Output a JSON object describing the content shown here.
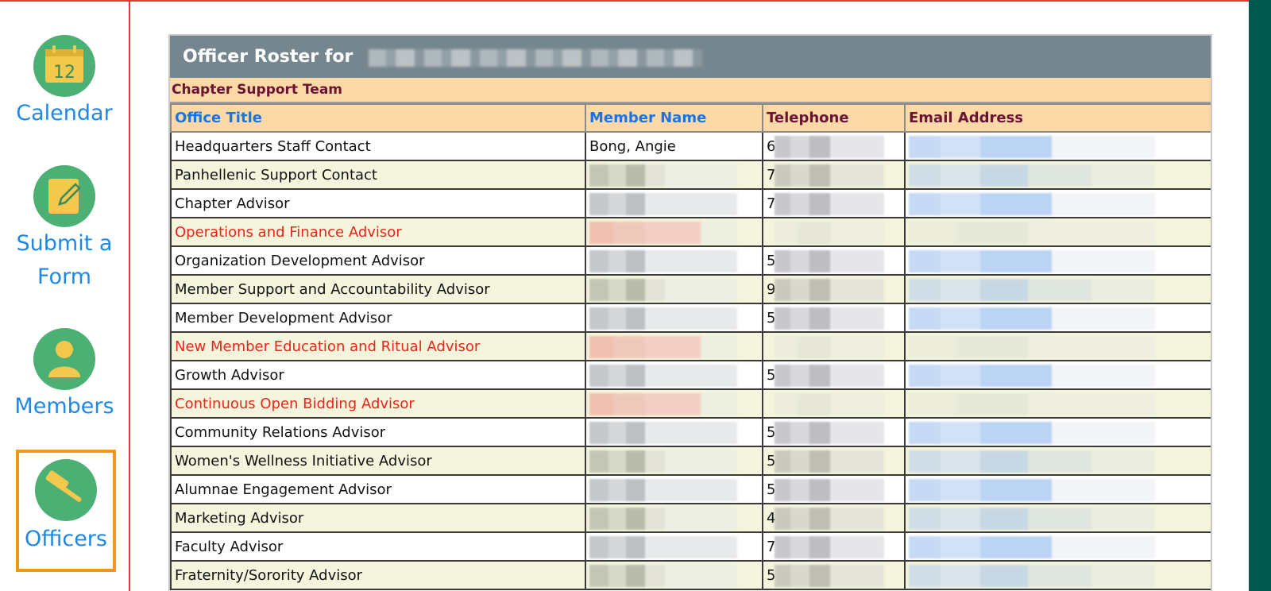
{
  "sidebar": {
    "items": [
      {
        "label_lines": [
          "Calendar"
        ],
        "icon": "calendar-icon",
        "icon_text": "12",
        "active": false
      },
      {
        "label_lines": [
          "Submit a",
          "Form"
        ],
        "icon": "form-edit-icon",
        "active": false
      },
      {
        "label_lines": [
          "Members"
        ],
        "icon": "person-icon",
        "active": false
      },
      {
        "label_lines": [
          "Officers"
        ],
        "icon": "gavel-icon",
        "active": true
      }
    ]
  },
  "panel": {
    "title": "Officer Roster for",
    "section": "Chapter Support Team",
    "columns": [
      "Office Title",
      "Member Name",
      "Telephone",
      "Email Address"
    ]
  },
  "rows": [
    {
      "title": "Headquarters Staff Contact",
      "name": "Bong, Angie",
      "red": false,
      "tel_lead": "6"
    },
    {
      "title": "Panhellenic Support Contact",
      "name": "",
      "red": false,
      "tel_lead": "7"
    },
    {
      "title": "Chapter Advisor",
      "name": "",
      "red": false,
      "tel_lead": "7"
    },
    {
      "title": "Operations and Finance Advisor",
      "name": "",
      "red": true,
      "tel_lead": ""
    },
    {
      "title": "Organization Development Advisor",
      "name": "",
      "red": false,
      "tel_lead": "5"
    },
    {
      "title": "Member Support and Accountability Advisor",
      "name": "",
      "red": false,
      "tel_lead": "9"
    },
    {
      "title": "Member Development Advisor",
      "name": "",
      "red": false,
      "tel_lead": "5"
    },
    {
      "title": "New Member Education and Ritual Advisor",
      "name": "",
      "red": true,
      "tel_lead": ""
    },
    {
      "title": "Growth Advisor",
      "name": "",
      "red": false,
      "tel_lead": "5"
    },
    {
      "title": "Continuous Open Bidding Advisor",
      "name": "",
      "red": true,
      "tel_lead": ""
    },
    {
      "title": "Community Relations Advisor",
      "name": "",
      "red": false,
      "tel_lead": "5"
    },
    {
      "title": "Women's Wellness Initiative Advisor",
      "name": "",
      "red": false,
      "tel_lead": "5"
    },
    {
      "title": "Alumnae Engagement Advisor",
      "name": "",
      "red": false,
      "tel_lead": "5"
    },
    {
      "title": "Marketing Advisor",
      "name": "",
      "red": false,
      "tel_lead": "4"
    },
    {
      "title": "Faculty Advisor",
      "name": "",
      "red": false,
      "tel_lead": "7"
    },
    {
      "title": "Fraternity/Sorority Advisor",
      "name": "",
      "red": false,
      "tel_lead": "5"
    }
  ],
  "colors": {
    "accent_red": "#e53935",
    "icon_green": "#4caf74",
    "link_blue": "#1e88e5",
    "active_orange": "#f7941d",
    "header_gray": "#76868f",
    "section_peach": "#fcd9a7",
    "right_bar": "#00584f"
  }
}
